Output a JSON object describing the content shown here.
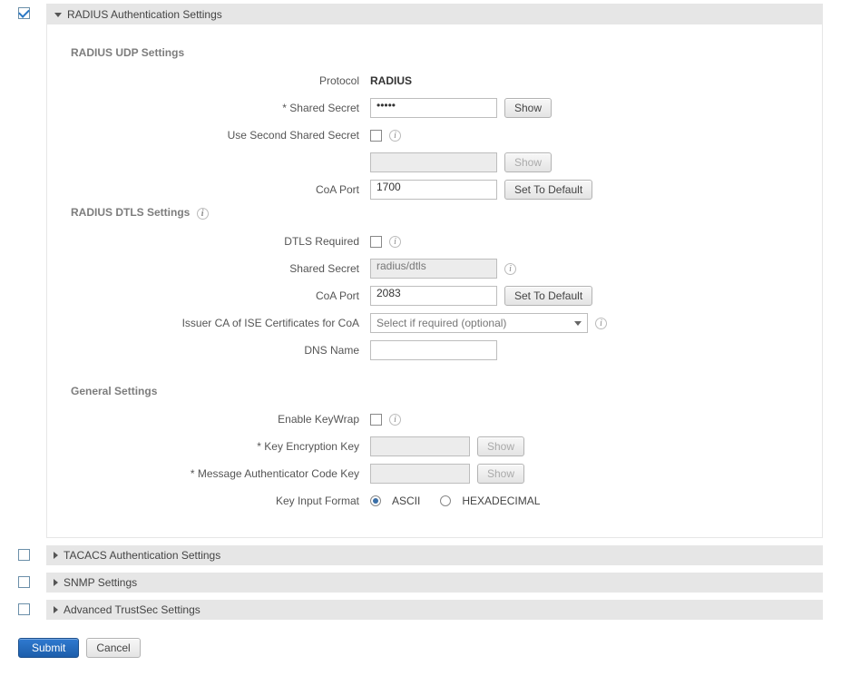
{
  "sections": {
    "radius": "RADIUS Authentication Settings",
    "tacacs": "TACACS Authentication Settings",
    "snmp": "SNMP Settings",
    "advanced": "Advanced TrustSec Settings"
  },
  "udp": {
    "heading": "RADIUS UDP Settings",
    "protocol_label": "Protocol",
    "protocol_value": "RADIUS",
    "shared_secret_label": "* Shared Secret",
    "shared_secret_value": "•••••",
    "show_btn": "Show",
    "second_label": "Use Second Shared Secret",
    "show2_btn": "Show",
    "coa_label": "CoA Port",
    "coa_value": "1700",
    "setdef_btn": "Set To Default"
  },
  "dtls": {
    "heading": "RADIUS DTLS Settings",
    "required_label": "DTLS Required",
    "shared_label": "Shared Secret",
    "shared_value": "radius/dtls",
    "coa_label": "CoA Port",
    "coa_value": "2083",
    "setdef_btn": "Set To Default",
    "issuer_label": "Issuer CA of ISE Certificates for CoA",
    "issuer_placeholder": "Select if required (optional)",
    "dns_label": "DNS Name"
  },
  "general": {
    "heading": "General Settings",
    "enable_label": "Enable KeyWrap",
    "kek_label": "*  Key Encryption Key",
    "mak_label": "*  Message Authenticator Code Key",
    "show_btn": "Show",
    "format_label": "Key Input Format",
    "ascii": "ASCII",
    "hex": "HEXADECIMAL"
  },
  "actions": {
    "submit": "Submit",
    "cancel": "Cancel"
  }
}
